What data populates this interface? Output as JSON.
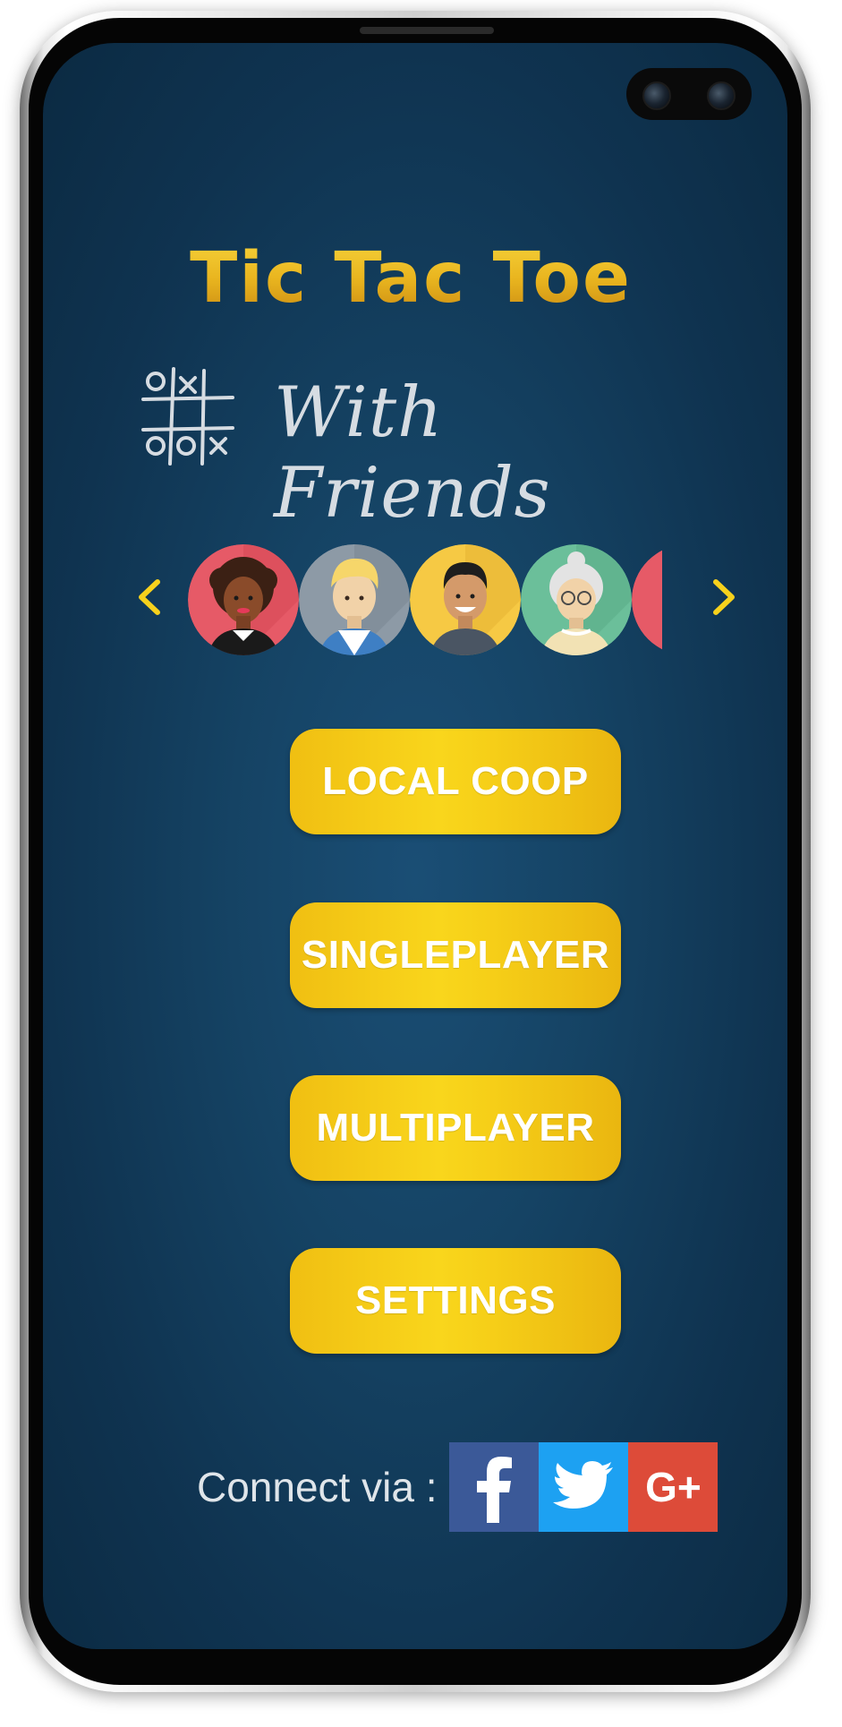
{
  "app": {
    "title": "Tic Tac Toe",
    "subtitle": "With Friends"
  },
  "carousel": {
    "prev_icon": "chevron-left-icon",
    "next_icon": "chevron-right-icon",
    "accent": "#f7d11c",
    "avatars": [
      {
        "name": "avatar-woman-curly-hair",
        "bg": "#e65a67"
      },
      {
        "name": "avatar-man-blond-hair",
        "bg": "#8d9aa6"
      },
      {
        "name": "avatar-man-black-hair",
        "bg": "#f6c944"
      },
      {
        "name": "avatar-grandmother-glasses",
        "bg": "#6bbf9a"
      },
      {
        "name": "avatar-partial",
        "bg": "#e65a67"
      }
    ]
  },
  "menu": {
    "local_coop": "LOCAL COOP",
    "singleplayer": "SINGLEPLAYER",
    "multiplayer": "MULTIPLAYER",
    "settings": "SETTINGS"
  },
  "connect": {
    "label": "Connect via :",
    "facebook": {
      "icon": "facebook-icon",
      "color": "#3b5998"
    },
    "twitter": {
      "icon": "twitter-icon",
      "color": "#1da1f2"
    },
    "google_plus": {
      "icon": "google-plus-icon",
      "color": "#dd4b39",
      "text": "G+"
    }
  }
}
